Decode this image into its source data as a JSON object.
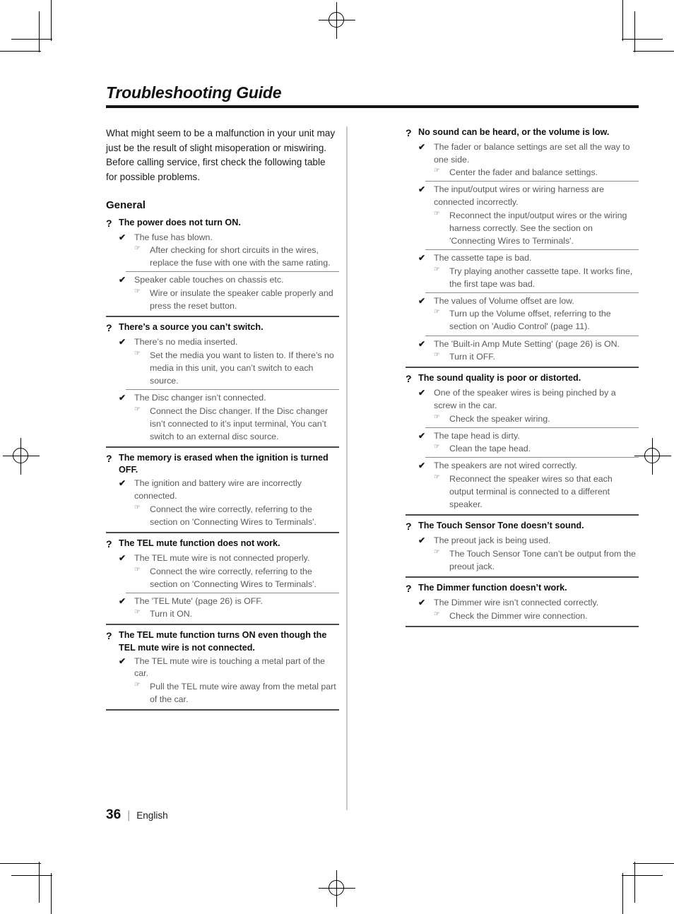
{
  "document": {
    "title": "Troubleshooting Guide",
    "intro": "What might seem to be a malfunction in your unit may just be the result of slight misoperation or miswiring. Before calling service, first check the following table for possible problems.",
    "section_heading": "General",
    "markers": {
      "question": "?",
      "cause": "✔",
      "action": "☞"
    }
  },
  "footer": {
    "page_number": "36",
    "separator": "|",
    "language": "English"
  },
  "left_column": [
    {
      "question": "The power does not turn ON.",
      "causes": [
        {
          "cause": "The fuse has blown.",
          "action": "After checking for short circuits in the wires, replace the fuse with one with the same rating."
        },
        {
          "cause": "Speaker cable touches on chassis etc.",
          "action": "Wire or insulate the speaker cable properly and press the reset button."
        }
      ]
    },
    {
      "question": "There’s a source you can’t switch.",
      "causes": [
        {
          "cause": "There’s no media inserted.",
          "action": "Set the media you want to listen to. If there’s no media in this unit, you can’t switch to each source."
        },
        {
          "cause": "The Disc changer isn’t connected.",
          "action": "Connect the Disc changer. If the Disc changer isn’t connected to it’s input terminal, You can’t switch to an external disc source."
        }
      ]
    },
    {
      "question": "The memory is erased when the ignition is turned OFF.",
      "causes": [
        {
          "cause": "The ignition and battery wire are incorrectly connected.",
          "action": "Connect the wire correctly, referring to the section on 'Connecting Wires to Terminals'."
        }
      ]
    },
    {
      "question": "The TEL mute function does not work.",
      "causes": [
        {
          "cause": "The TEL mute wire is not connected properly.",
          "action": "Connect the wire correctly, referring to the section on 'Connecting Wires to Terminals'."
        },
        {
          "cause": "The 'TEL Mute' (page 26) is OFF.",
          "action": "Turn it ON."
        }
      ]
    },
    {
      "question": "The TEL mute function turns ON even though the TEL mute wire is not connected.",
      "causes": [
        {
          "cause": "The TEL mute wire is touching a metal part of the car.",
          "action": "Pull the TEL mute wire away from the metal part of the car."
        }
      ]
    }
  ],
  "right_column": [
    {
      "question": "No sound can be heard, or the volume is low.",
      "causes": [
        {
          "cause": "The fader or balance settings are set all the way to one side.",
          "action": "Center the fader and balance settings."
        },
        {
          "cause": "The input/output wires or wiring harness are connected incorrectly.",
          "action": "Reconnect the input/output wires or the wiring harness correctly. See the section on 'Connecting Wires to Terminals'."
        },
        {
          "cause": "The cassette tape is bad.",
          "action": "Try playing another cassette tape. It works fine, the first tape was bad."
        },
        {
          "cause": "The values of Volume offset are low.",
          "action": "Turn up the Volume offset, referring to the section on 'Audio Control' (page 11)."
        },
        {
          "cause": "The 'Built-in Amp Mute Setting' (page 26) is ON.",
          "action": "Turn it OFF."
        }
      ]
    },
    {
      "question": "The sound quality is poor or distorted.",
      "causes": [
        {
          "cause": "One of the speaker wires is being pinched by a screw in the car.",
          "action": "Check the speaker wiring."
        },
        {
          "cause": "The tape head is dirty.",
          "action": "Clean the tape head."
        },
        {
          "cause": "The speakers are not wired correctly.",
          "action": "Reconnect the speaker wires so that each output terminal is connected to a different speaker."
        }
      ]
    },
    {
      "question": "The Touch Sensor Tone doesn’t sound.",
      "causes": [
        {
          "cause": "The preout jack is being used.",
          "action": "The Touch Sensor Tone can’t be output from the preout jack."
        }
      ]
    },
    {
      "question": "The Dimmer function doesn’t work.",
      "causes": [
        {
          "cause": "The Dimmer wire isn’t connected correctly.",
          "action": "Check the Dimmer wire connection."
        }
      ]
    }
  ]
}
